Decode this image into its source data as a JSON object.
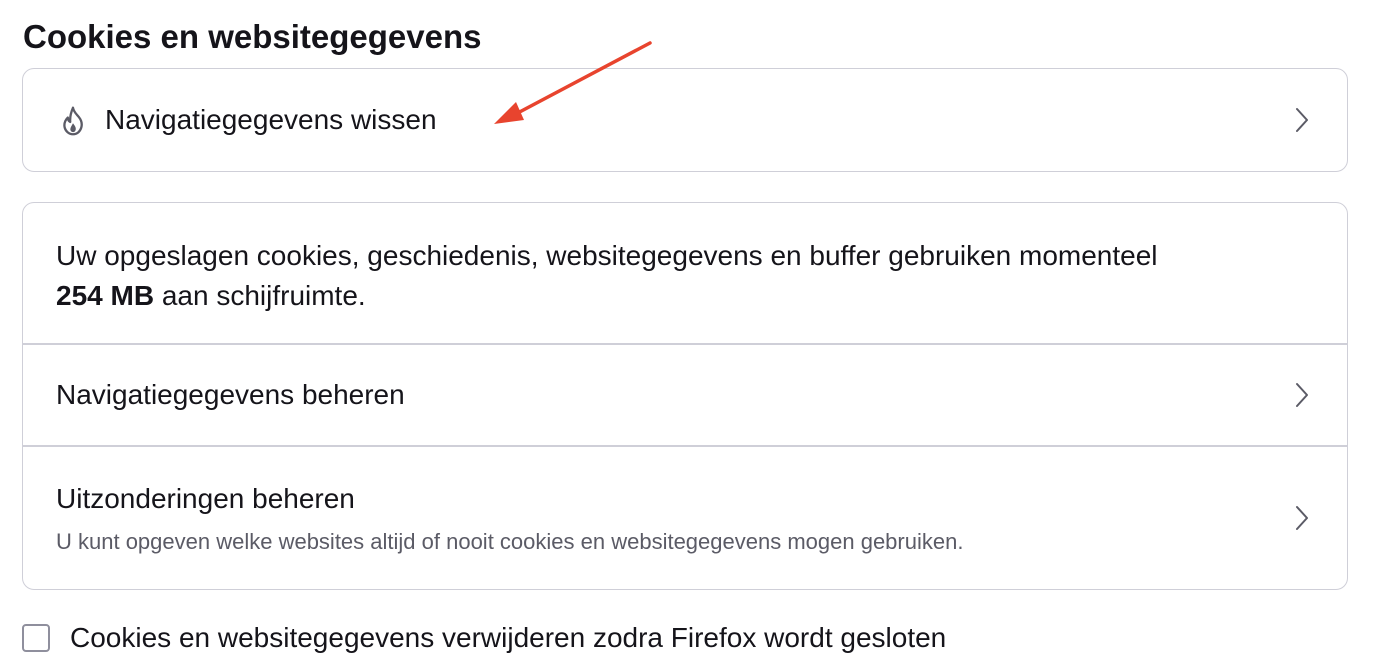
{
  "section": {
    "title": "Cookies en websitegegevens"
  },
  "clear_data": {
    "label": "Navigatiegegevens wissen",
    "icon": "flame-icon"
  },
  "storage": {
    "text_before": "Uw opgeslagen cookies, geschiedenis, websitegegevens en buffer gebruiken momenteel",
    "size": "254 MB",
    "text_after": "aan schijfruimte."
  },
  "manage_data": {
    "label": "Navigatiegegevens beheren"
  },
  "exceptions": {
    "label": "Uitzonderingen beheren",
    "description": "U kunt opgeven welke websites altijd of nooit cookies en websitegegevens mogen gebruiken."
  },
  "delete_on_close": {
    "label": "Cookies en websitegegevens verwijderen zodra Firefox wordt gesloten",
    "checked": false
  },
  "annotation": {
    "arrow_color": "#e8442e"
  }
}
